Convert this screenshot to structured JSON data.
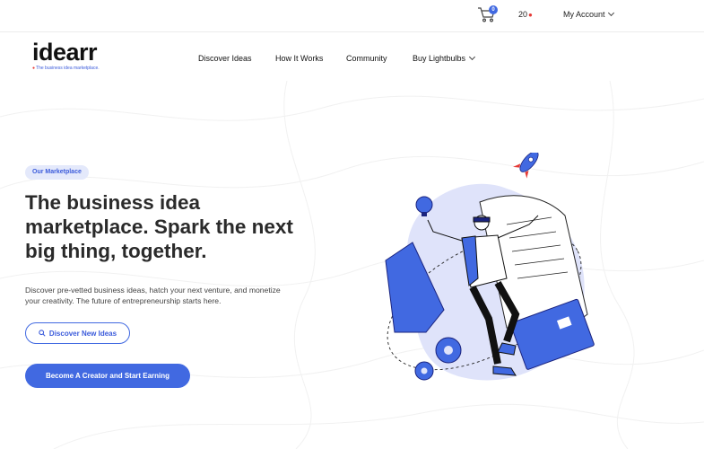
{
  "topbar": {
    "cart_count": "0",
    "bulb_count": "20",
    "account_label": "My Account"
  },
  "header": {
    "logo": "idearr",
    "tagline": "The business idea marketplace.",
    "nav": [
      "Discover Ideas",
      "How It Works",
      "Community",
      "Buy Lightbulbs"
    ]
  },
  "hero": {
    "pill": "Our Marketplace",
    "title": "The business idea marketplace. Spark the next big thing, together.",
    "description": "Discover pre-vetted business ideas, hatch your next venture, and monetize your creativity. The future of entrepreneurship starts here.",
    "discover_button": "Discover New Ideas",
    "creator_button": "Become A Creator and Start Earning"
  },
  "colors": {
    "accent": "#4169e1",
    "pill_bg": "#e4e9fb",
    "illustration_bg": "#dfe3fa"
  },
  "icons": [
    "cart-icon",
    "lightbulb-pin-icon",
    "chevron-down-icon",
    "search-icon",
    "rocket-icon"
  ]
}
